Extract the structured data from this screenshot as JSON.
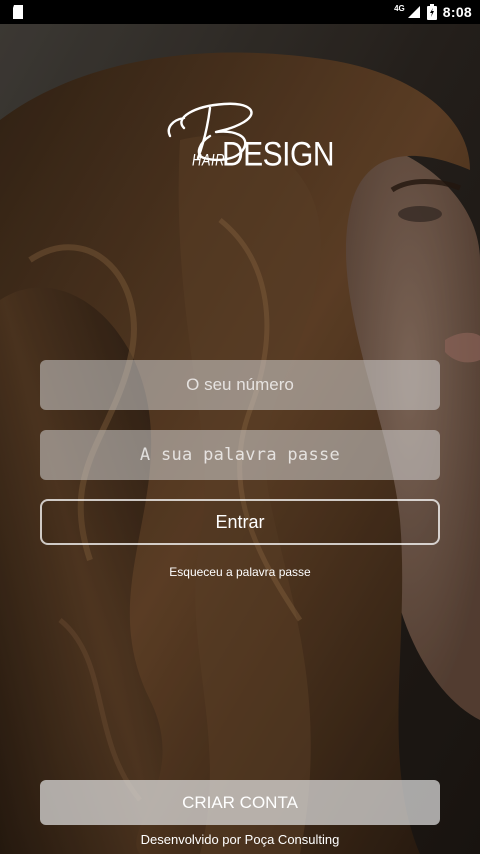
{
  "status_bar": {
    "network": "4G",
    "time": "8:08",
    "icons": [
      "sd-card-icon",
      "signal-icon",
      "battery-charging-icon"
    ]
  },
  "logo": {
    "letter": "B",
    "hair": "HAIR",
    "design": "DESIGN"
  },
  "login": {
    "phone_placeholder": "O seu número",
    "password_placeholder": "A sua palavra passe",
    "enter_label": "Entrar",
    "forgot_label": "Esqueceu a palavra passe"
  },
  "create_account_label": "CRIAR CONTA",
  "footer_text": "Desenvolvido por Poça Consulting",
  "colors": {
    "background_dark": "#2a221b",
    "hair_brown": "#5a3d24",
    "field_bg": "#d2d2d2",
    "text": "#ffffff"
  }
}
